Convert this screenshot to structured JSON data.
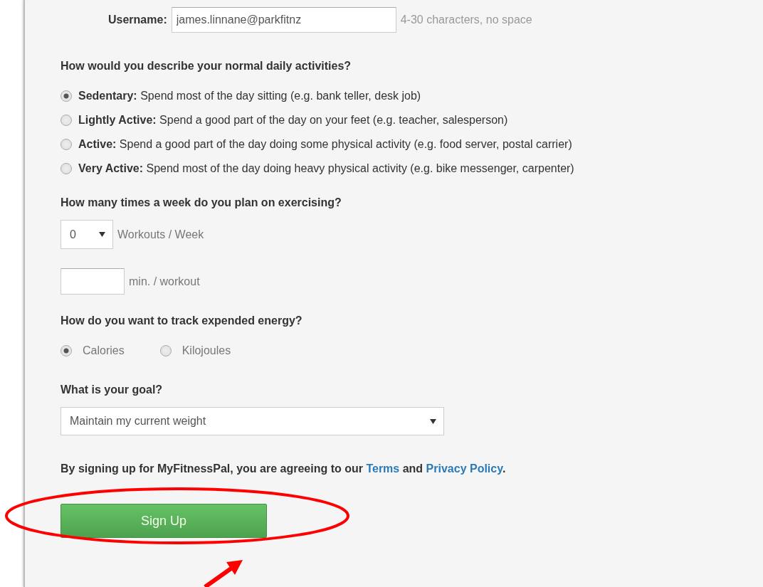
{
  "username": {
    "label": "Username:",
    "value": "james.linnane@parkfitnz",
    "hint": "4-30 characters, no space"
  },
  "activity": {
    "question": "How would you describe your normal daily activities?",
    "options": [
      {
        "title": "Sedentary:",
        "description": "Spend most of the day sitting (e.g. bank teller, desk job)",
        "selected": true
      },
      {
        "title": "Lightly Active:",
        "description": "Spend a good part of the day on your feet (e.g. teacher, salesperson)",
        "selected": false
      },
      {
        "title": "Active:",
        "description": "Spend a good part of the day doing some physical activity (e.g. food server, postal carrier)",
        "selected": false
      },
      {
        "title": "Very Active:",
        "description": "Spend most of the day doing heavy physical activity (e.g. bike messenger, carpenter)",
        "selected": false
      }
    ]
  },
  "exercise": {
    "question": "How many times a week do you plan on exercising?",
    "workouts": {
      "value": "0",
      "unit": "Workouts / Week"
    },
    "minutes": {
      "unit": "min. / workout"
    }
  },
  "energy": {
    "question": "How do you want to track expended energy?",
    "options": [
      {
        "label": "Calories",
        "selected": true
      },
      {
        "label": "Kilojoules",
        "selected": false
      }
    ]
  },
  "goal": {
    "question": "What is your goal?",
    "value": "Maintain my current weight"
  },
  "terms": {
    "parts": [
      {
        "kind": "text",
        "text": "By signing up for MyFitnessPal, you are agreeing to our "
      },
      {
        "kind": "link",
        "text": "Terms"
      },
      {
        "kind": "text",
        "text": " and "
      },
      {
        "kind": "link",
        "text": "Privacy Policy"
      },
      {
        "kind": "text",
        "text": "."
      }
    ]
  },
  "submit": {
    "label": "Sign Up"
  },
  "annotations": {
    "highlight_ellipse": true,
    "arrow": true
  }
}
